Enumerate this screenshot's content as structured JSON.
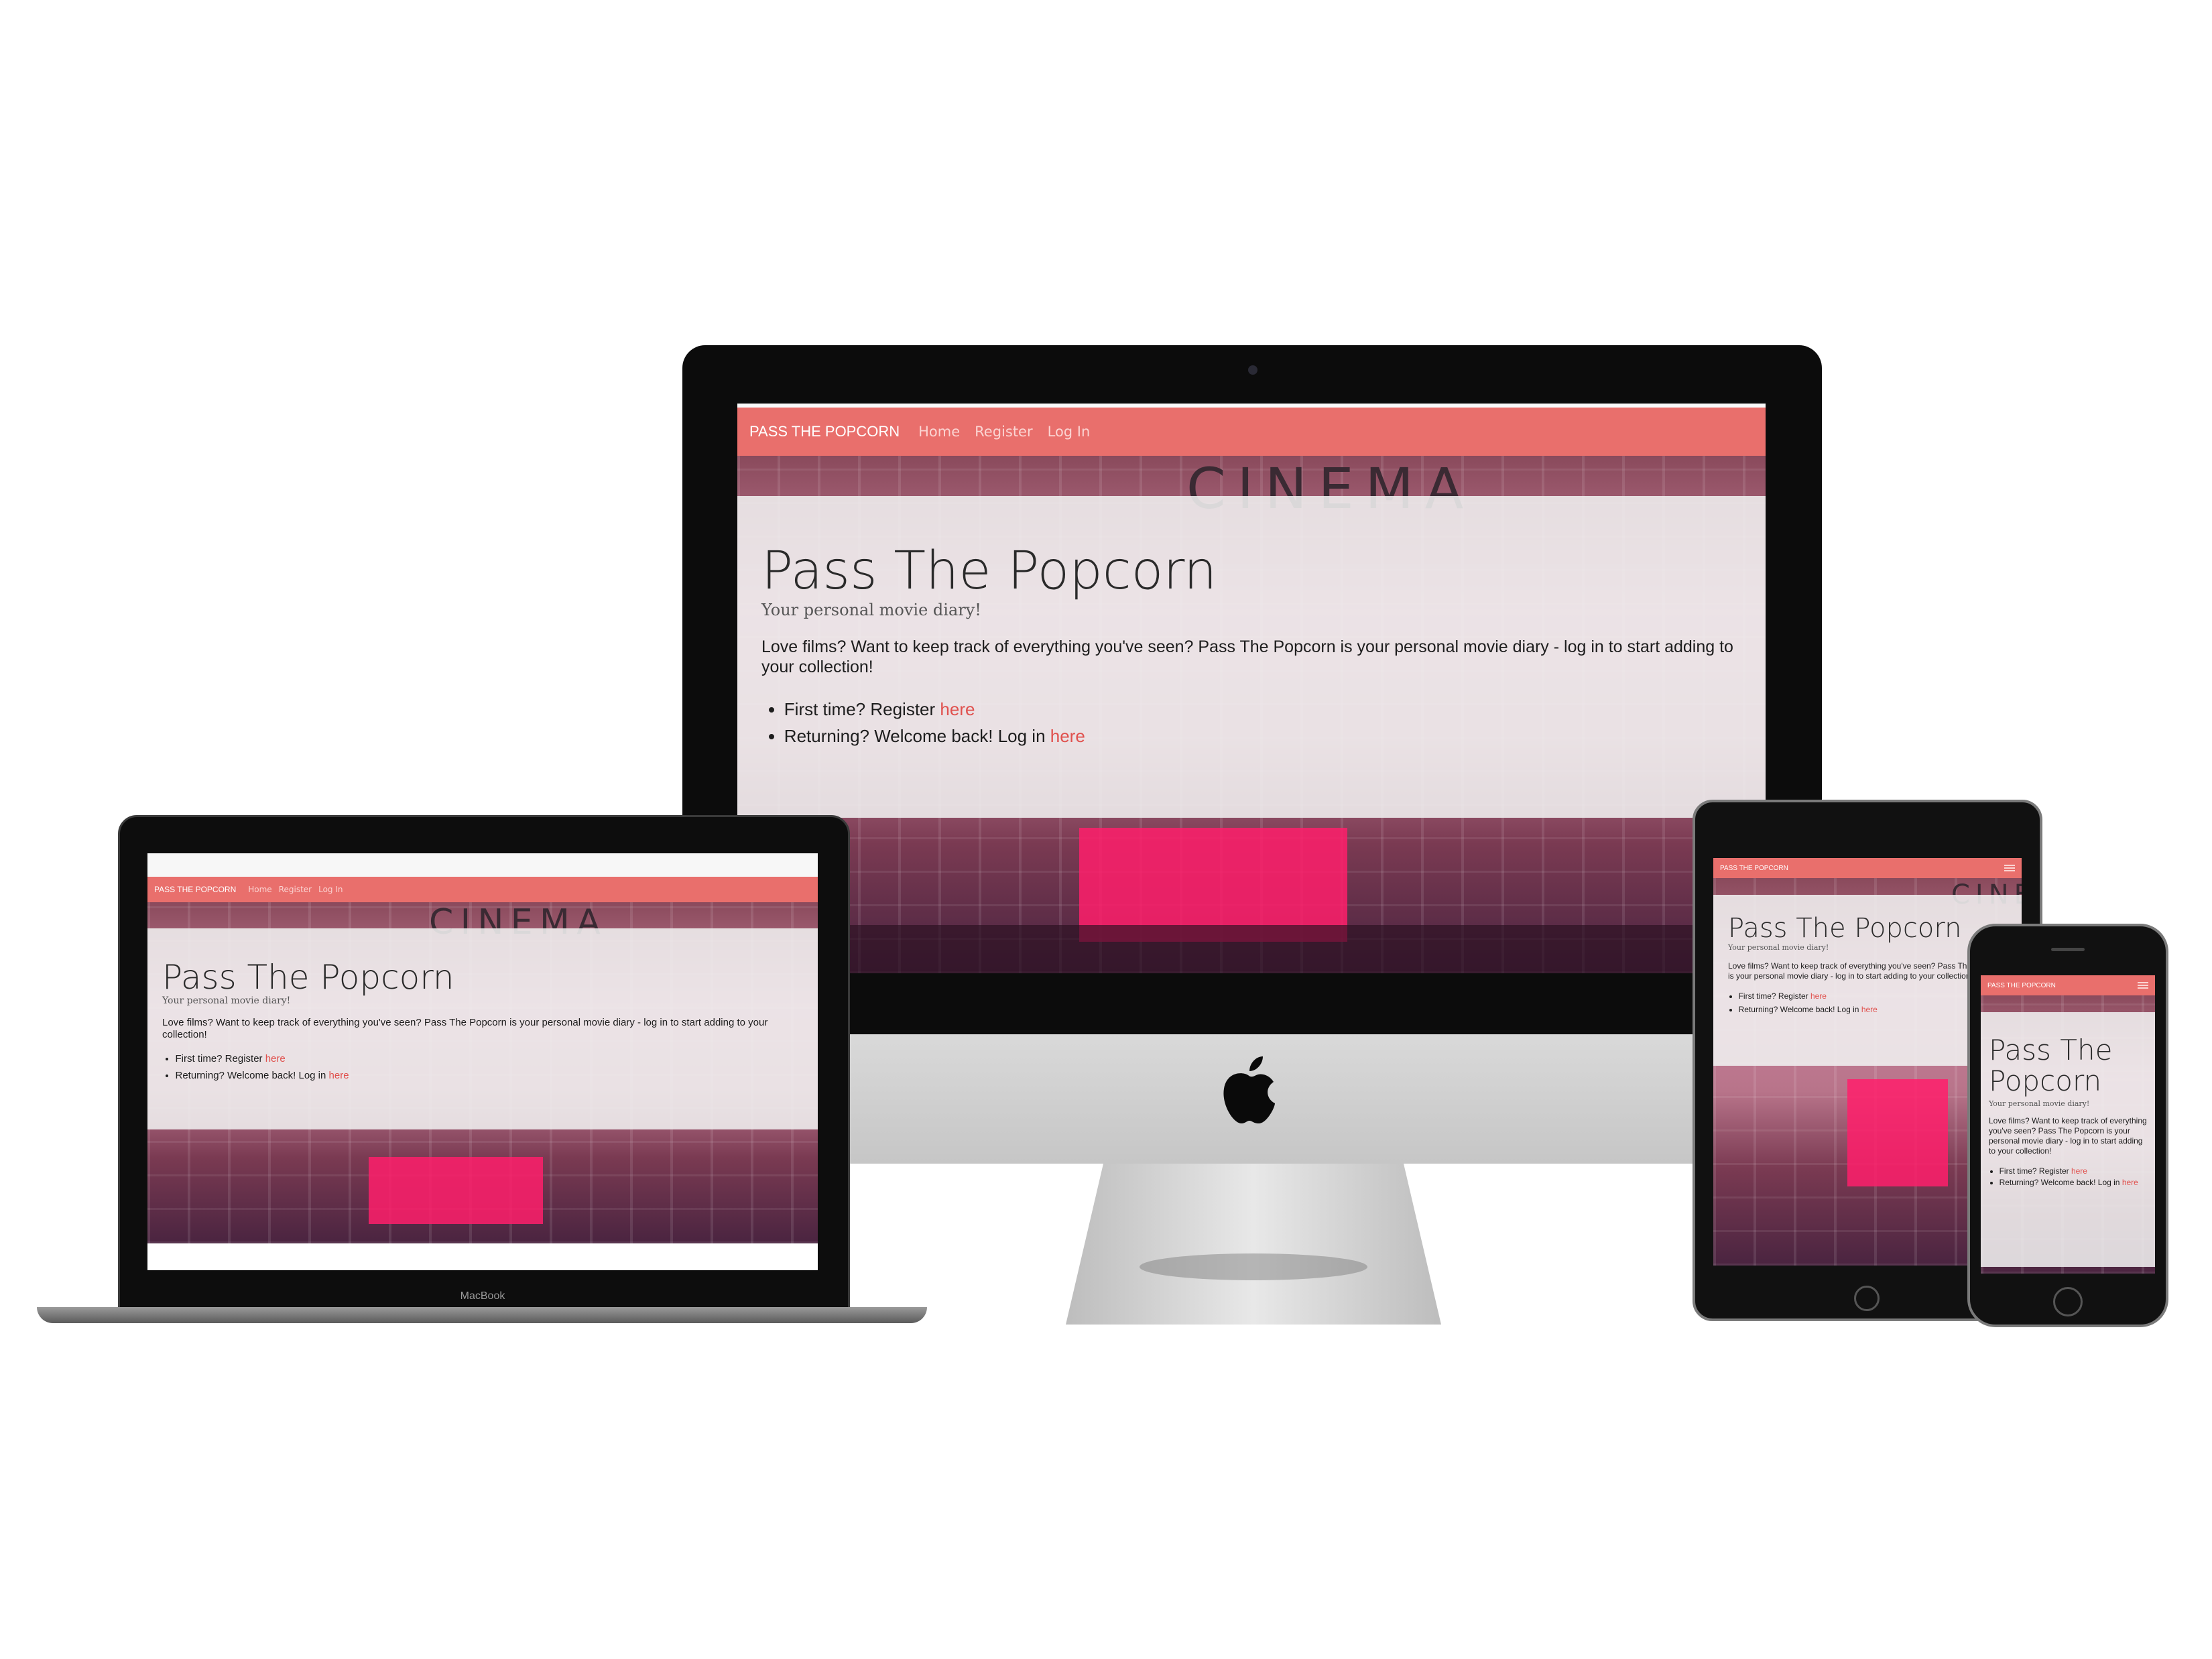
{
  "site": {
    "brand": "PASS THE POPCORN",
    "nav": [
      "Home",
      "Register",
      "Log In"
    ],
    "hero_sign": "CINEMA",
    "title": "Pass The Popcorn",
    "tagline": "Your personal movie diary!",
    "intro": "Love films? Want to keep track of everything you've seen? Pass The Popcorn is your personal movie diary - log in to start adding to your collection!",
    "option1_prefix": "First time? Register ",
    "option2_prefix": "Returning? Welcome back! Log in ",
    "link_text": "here"
  },
  "devices": {
    "laptop_label": "MacBook"
  },
  "colors": {
    "navbar": "#e96f6c",
    "link": "#e0504d",
    "accent_neon": "#ff1f6b"
  },
  "icons": [
    "apple-logo-icon",
    "hamburger-menu-icon",
    "home-button-icon",
    "camera-icon"
  ]
}
